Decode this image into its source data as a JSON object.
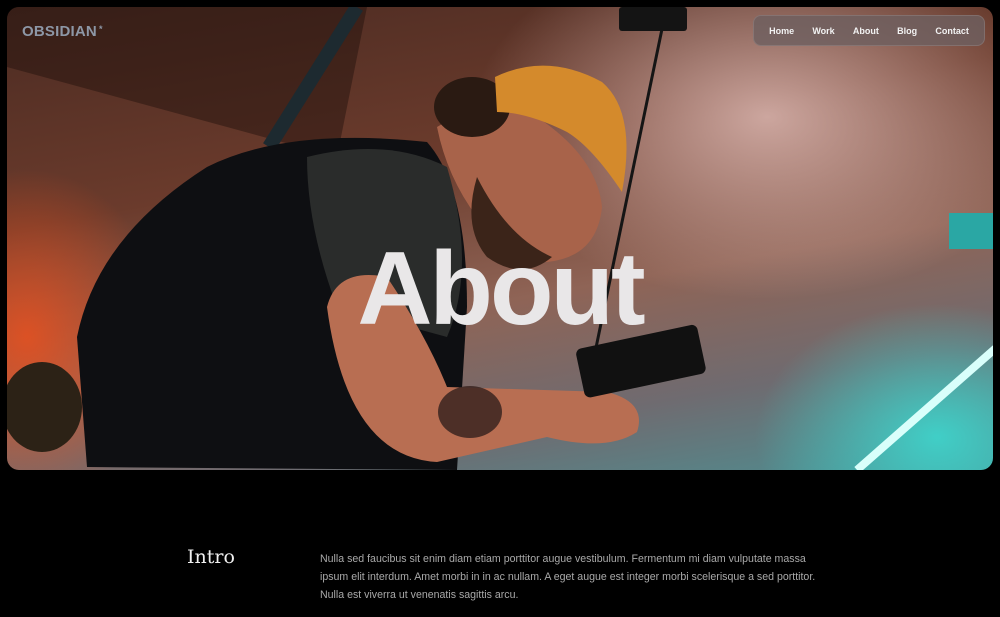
{
  "brand": {
    "name": "OBSIDIAN",
    "mark": "*"
  },
  "nav": {
    "items": [
      "Home",
      "Work",
      "About",
      "Blog",
      "Contact"
    ]
  },
  "hero": {
    "title": "About"
  },
  "intro": {
    "heading": "Intro",
    "body": "Nulla sed faucibus sit enim diam etiam porttitor augue vestibulum. Fermentum mi diam vulputate massa ipsum elit interdum. Amet morbi in in ac nullam. A eget augue est integer morbi scelerisque a sed porttitor. Nulla est viverra ut venenatis sagittis arcu."
  },
  "colors": {
    "background": "#000000",
    "brand": "#8d97a6",
    "title": "#e9e7e8",
    "body_text": "#a9a9a9",
    "beanie": "#d48a2c",
    "neon": "#4fe3dc"
  }
}
